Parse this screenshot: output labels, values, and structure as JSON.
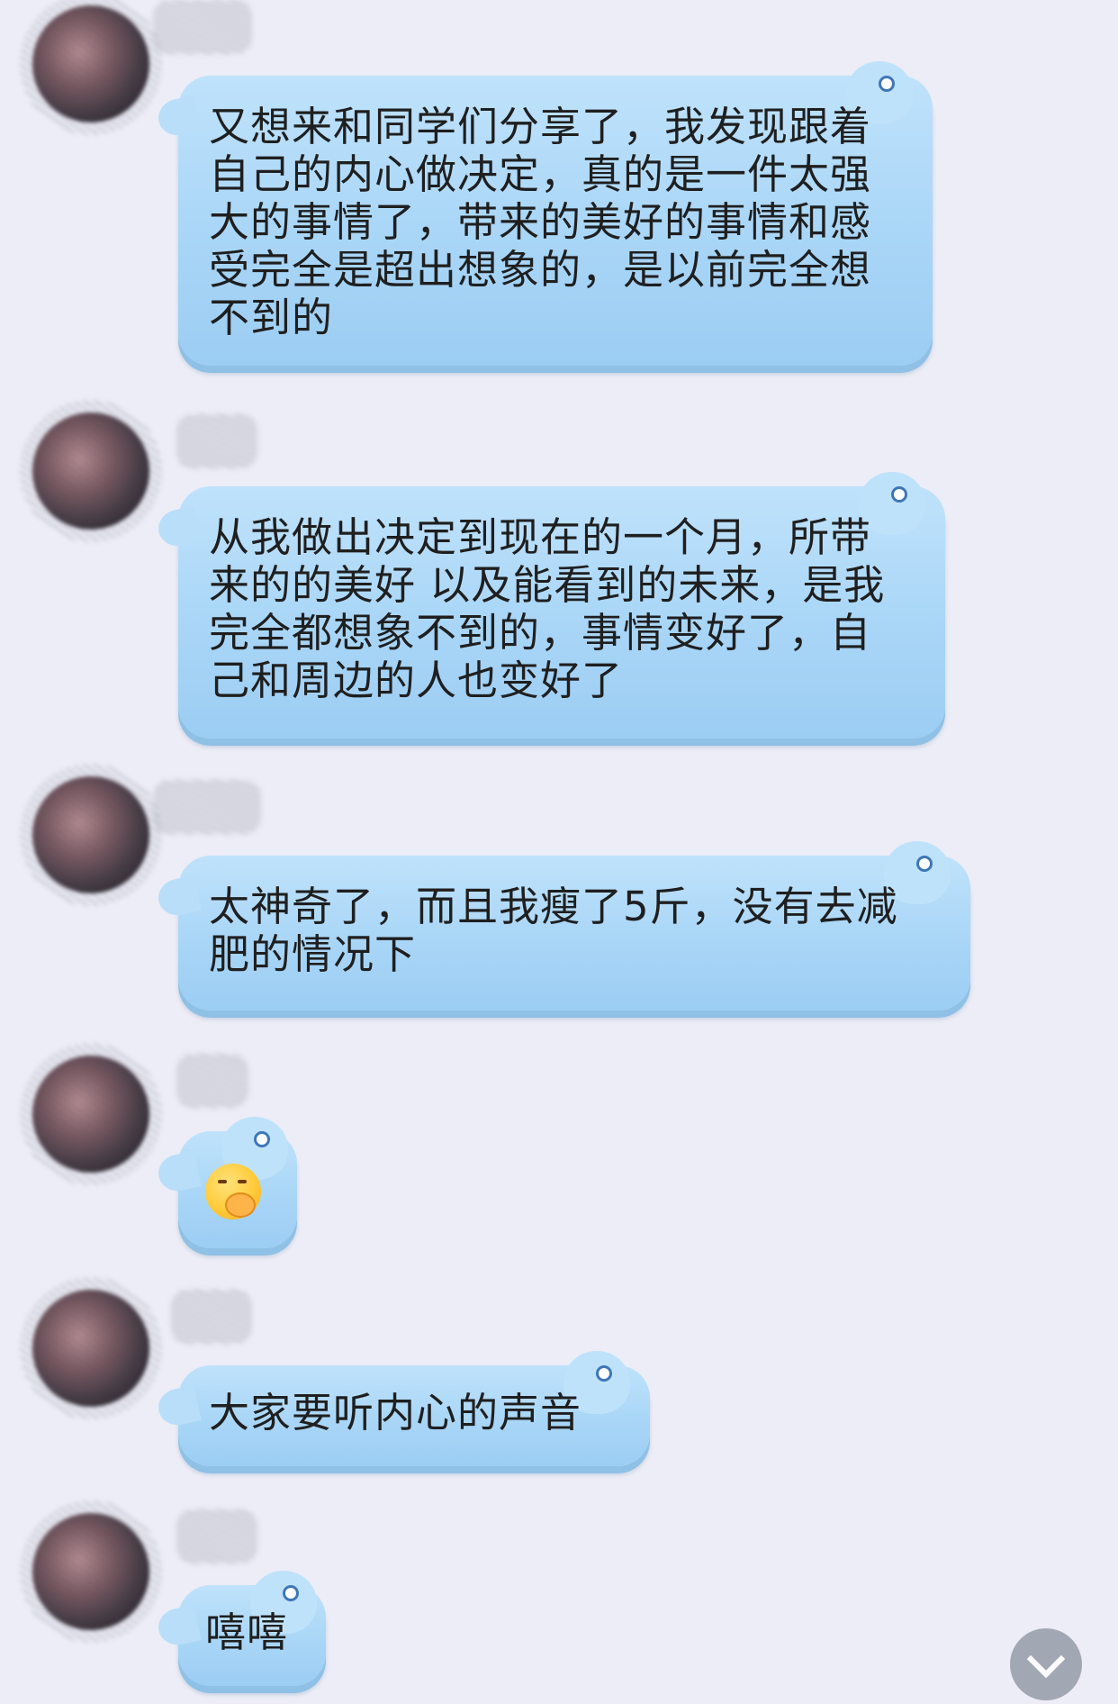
{
  "messages": [
    {
      "text": "又想来和同学们分享了，我发现跟着自己的内心做决定，真的是一件太强大的事情了，带来的美好的事情和感受完全是超出想象的，是以前完全想不到的"
    },
    {
      "text": "从我做出决定到现在的一个月，所带来的的美好 以及能看到的未来，是我完全都想象不到的，事情变好了，自己和周边的人也变好了"
    },
    {
      "text": "太神奇了，而且我瘦了5斤，没有去减肥的情况下"
    },
    {
      "emoji": "hand-over-mouth-emoji"
    },
    {
      "text": "大家要听内心的声音"
    },
    {
      "text": "嘻嘻"
    }
  ],
  "colors": {
    "background": "#ecedf6",
    "bubble": "#a9d6f7",
    "text": "#1f1f1f"
  },
  "scroll_button": {
    "icon": "chevron-down-icon"
  }
}
